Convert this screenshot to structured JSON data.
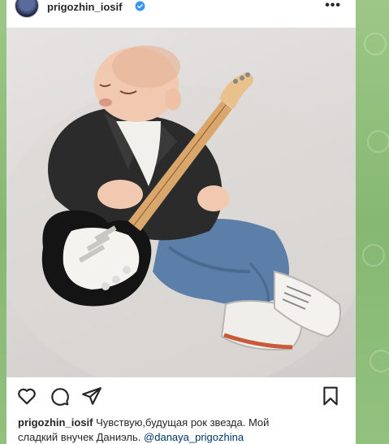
{
  "post": {
    "username": "prigozhin_iosif",
    "verified": true,
    "more_label": "•••"
  },
  "photo": {
    "subject": "baby-in-leather-jacket-with-electric-guitar"
  },
  "actions": {
    "icons": [
      "heart-icon",
      "comment-icon",
      "share-icon",
      "bookmark-icon"
    ]
  },
  "caption": {
    "username": "prigozhin_iosif",
    "text_line1": " Чувствую,будущая рок звезда.  Мой",
    "text_line2": "сладкий внучек Даниэль.  ",
    "mention": "@danaya_prigozhina"
  },
  "colors": {
    "verified_blue": "#3897f0",
    "background_green": "#8fbf7a",
    "text": "#262626",
    "mention": "#00376b"
  }
}
